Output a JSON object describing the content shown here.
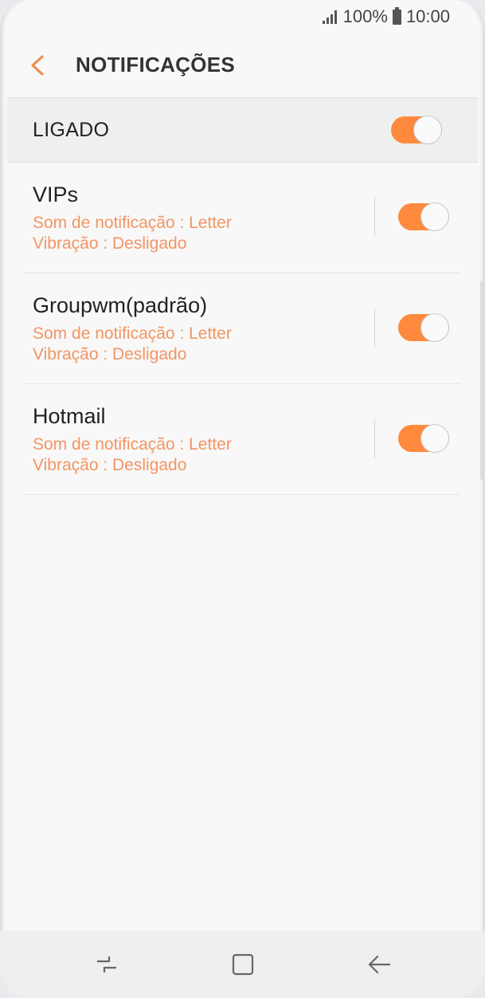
{
  "status_bar": {
    "battery_text": "100%",
    "time": "10:00"
  },
  "header": {
    "title": "NOTIFICAÇÕES"
  },
  "master": {
    "label": "LIGADO",
    "enabled": true
  },
  "accounts": [
    {
      "name": "VIPs",
      "sound": "Som de notificação : Letter",
      "vibration": "Vibração : Desligado",
      "enabled": true
    },
    {
      "name": "Groupwm(padrão)",
      "sound": "Som de notificação : Letter",
      "vibration": "Vibração : Desligado",
      "enabled": true
    },
    {
      "name": "Hotmail",
      "sound": "Som de notificação : Letter",
      "vibration": "Vibração : Desligado",
      "enabled": true
    }
  ],
  "colors": {
    "accent": "#ff8a3d",
    "subtext": "#f39562"
  },
  "navbar": {
    "icons": [
      "recent-apps-icon",
      "home-icon",
      "back-arrow-icon"
    ]
  }
}
